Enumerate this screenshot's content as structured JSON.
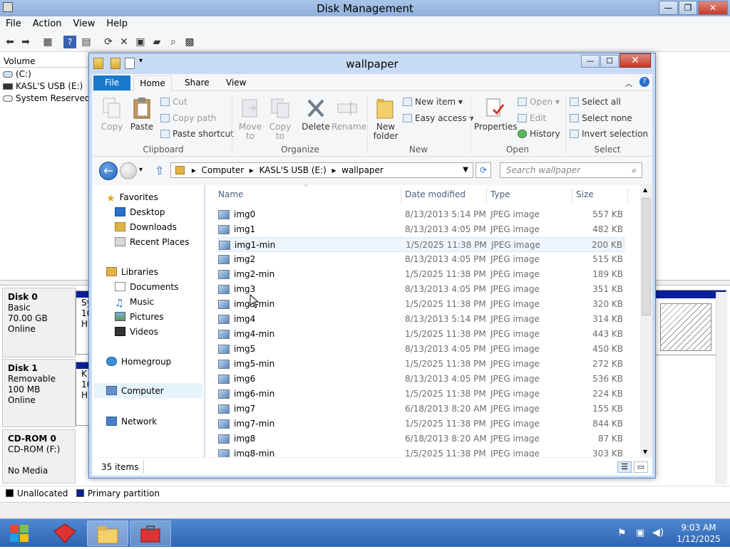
{
  "dm": {
    "title": "Disk Management",
    "menu": [
      "File",
      "Action",
      "View",
      "Help"
    ],
    "volume_header": "Volume",
    "volumes": [
      "(C:)",
      "KASL'S USB (E:)",
      "System Reserved"
    ],
    "disks": [
      {
        "name": "Disk 0",
        "type": "Basic",
        "size": "70.00 GB",
        "status": "Online",
        "part_prefix": [
          "Sy",
          "10",
          "H"
        ]
      },
      {
        "name": "Disk 1",
        "type": "Removable",
        "size": "100 MB",
        "status": "Online",
        "part_prefix": [
          "K",
          "10",
          "H"
        ]
      },
      {
        "name": "CD-ROM 0",
        "type": "CD-ROM (F:)",
        "size": "",
        "status": "No Media"
      }
    ],
    "legend": {
      "unallocated": "Unallocated",
      "primary": "Primary partition",
      "unallocated_color": "#000000",
      "primary_color": "#0a1f9a"
    },
    "window_buttons": {
      "minimize": "—",
      "restore": "❐",
      "close": "✕"
    }
  },
  "explorer": {
    "title": "wallpaper",
    "tabs": {
      "file": "File",
      "home": "Home",
      "share": "Share",
      "view": "View"
    },
    "ribbon": {
      "clipboard": {
        "copy": "Copy",
        "paste": "Paste",
        "cut": "Cut",
        "copy_path": "Copy path",
        "paste_shortcut": "Paste shortcut",
        "group": "Clipboard"
      },
      "organize": {
        "move_to": "Move to",
        "copy_to": "Copy to",
        "delete": "Delete",
        "rename": "Rename",
        "group": "Organize"
      },
      "new": {
        "new_folder": "New folder",
        "new_item": "New item",
        "easy_access": "Easy access",
        "group": "New"
      },
      "open": {
        "properties": "Properties",
        "open": "Open",
        "edit": "Edit",
        "history": "History",
        "group": "Open"
      },
      "select": {
        "select_all": "Select all",
        "select_none": "Select none",
        "invert": "Invert selection",
        "group": "Select"
      }
    },
    "address": [
      "Computer",
      "KASL'S USB (E:)",
      "wallpaper"
    ],
    "search_placeholder": "Search wallpaper",
    "nav": {
      "favorites": "Favorites",
      "desktop": "Desktop",
      "downloads": "Downloads",
      "recent": "Recent Places",
      "libraries": "Libraries",
      "documents": "Documents",
      "music": "Music",
      "pictures": "Pictures",
      "videos": "Videos",
      "homegroup": "Homegroup",
      "computer": "Computer",
      "network": "Network"
    },
    "columns": {
      "name": "Name",
      "date": "Date modified",
      "type": "Type",
      "size": "Size"
    },
    "files": [
      {
        "name": "img0",
        "date": "8/13/2013 5:14 PM",
        "type": "JPEG image",
        "size": "557 KB"
      },
      {
        "name": "img1",
        "date": "8/13/2013 4:05 PM",
        "type": "JPEG image",
        "size": "482 KB"
      },
      {
        "name": "img1-min",
        "date": "1/5/2025 11:38 PM",
        "type": "JPEG image",
        "size": "200 KB"
      },
      {
        "name": "img2",
        "date": "8/13/2013 4:05 PM",
        "type": "JPEG image",
        "size": "515 KB"
      },
      {
        "name": "img2-min",
        "date": "1/5/2025 11:38 PM",
        "type": "JPEG image",
        "size": "189 KB"
      },
      {
        "name": "img3",
        "date": "8/13/2013 4:05 PM",
        "type": "JPEG image",
        "size": "351 KB"
      },
      {
        "name": "img3-min",
        "date": "1/5/2025 11:38 PM",
        "type": "JPEG image",
        "size": "320 KB"
      },
      {
        "name": "img4",
        "date": "8/13/2013 5:14 PM",
        "type": "JPEG image",
        "size": "314 KB"
      },
      {
        "name": "img4-min",
        "date": "1/5/2025 11:38 PM",
        "type": "JPEG image",
        "size": "443 KB"
      },
      {
        "name": "img5",
        "date": "8/13/2013 4:05 PM",
        "type": "JPEG image",
        "size": "450 KB"
      },
      {
        "name": "img5-min",
        "date": "1/5/2025 11:38 PM",
        "type": "JPEG image",
        "size": "272 KB"
      },
      {
        "name": "img6",
        "date": "8/13/2013 4:05 PM",
        "type": "JPEG image",
        "size": "536 KB"
      },
      {
        "name": "img6-min",
        "date": "1/5/2025 11:38 PM",
        "type": "JPEG image",
        "size": "224 KB"
      },
      {
        "name": "img7",
        "date": "6/18/2013 8:20 AM",
        "type": "JPEG image",
        "size": "155 KB"
      },
      {
        "name": "img7-min",
        "date": "1/5/2025 11:38 PM",
        "type": "JPEG image",
        "size": "844 KB"
      },
      {
        "name": "img8",
        "date": "6/18/2013 8:20 AM",
        "type": "JPEG image",
        "size": "87 KB"
      },
      {
        "name": "img8-min",
        "date": "1/5/2025 11:38 PM",
        "type": "JPEG image",
        "size": "303 KB"
      }
    ],
    "status": "35 items"
  },
  "taskbar": {
    "time": "9:03 AM",
    "date": "1/12/2025"
  },
  "colors": {
    "titlebar": "#a8c4e8",
    "accent": "#1979ca",
    "taskbar": "#3a72c2"
  }
}
